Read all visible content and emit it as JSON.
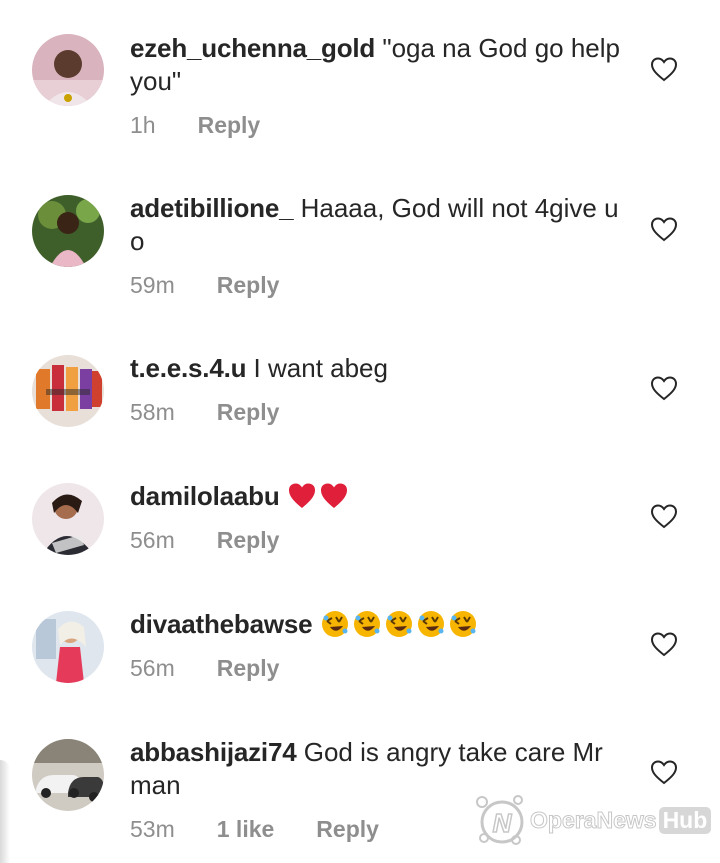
{
  "comments": [
    {
      "username": "ezeh_uchenna_gold",
      "text": "\"oga na God go help you\"",
      "time": "1h",
      "likes": "",
      "reply_label": "Reply",
      "avatar_icon": "avatar-man-photo"
    },
    {
      "username": "adetibillione_",
      "text": "Haaaa, God will not 4give u o",
      "time": "59m",
      "likes": "",
      "reply_label": "Reply",
      "avatar_icon": "avatar-child-photo"
    },
    {
      "username": "t.e.e.s.4.u",
      "text": "I want abeg",
      "time": "58m",
      "likes": "",
      "reply_label": "Reply",
      "avatar_icon": "avatar-clothing-photo"
    },
    {
      "username": "damilolaabu",
      "text": "",
      "emojis": [
        "red-heart-emoji",
        "red-heart-emoji"
      ],
      "time": "56m",
      "likes": "",
      "reply_label": "Reply",
      "avatar_icon": "avatar-woman-photo"
    },
    {
      "username": "divaathebawse",
      "text": "",
      "emojis": [
        "rolling-laughing-emoji",
        "rolling-laughing-emoji",
        "rolling-laughing-emoji",
        "rolling-laughing-emoji",
        "rolling-laughing-emoji"
      ],
      "time": "56m",
      "likes": "",
      "reply_label": "Reply",
      "avatar_icon": "avatar-woman-standing-photo"
    },
    {
      "username": "abbashijazi74",
      "text": "God is angry take care Mr man",
      "time": "53m",
      "likes": "1 like",
      "reply_label": "Reply",
      "avatar_icon": "avatar-cars-photo"
    }
  ],
  "watermark": {
    "brand": "OperaNews",
    "hub": "Hub"
  },
  "colors": {
    "text": "#262626",
    "meta": "#8e8e8e",
    "heart_emoji": "#e0203a",
    "laugh_emoji": "#f7b500"
  }
}
